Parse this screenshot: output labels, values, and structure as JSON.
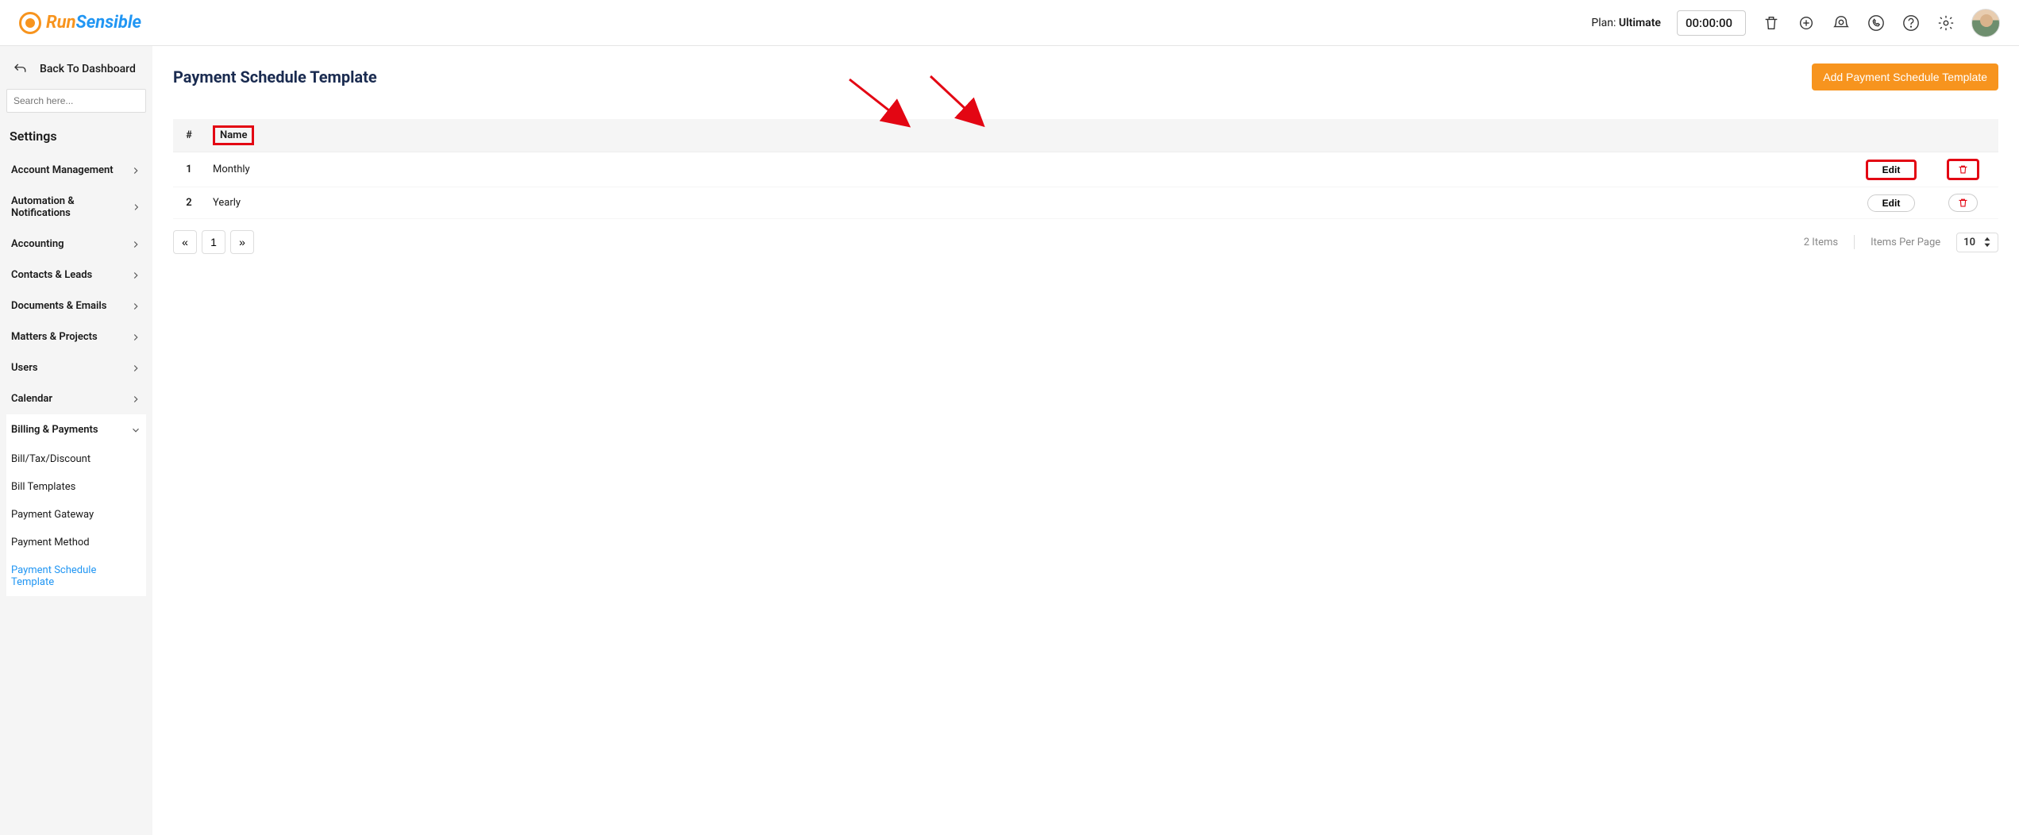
{
  "header": {
    "logo_run": "Run",
    "logo_sensible": "Sensible",
    "plan_label": "Plan: ",
    "plan_value": "Ultimate",
    "timer": "00:00:00"
  },
  "sidebar": {
    "back_label": "Back To Dashboard",
    "search_placeholder": "Search here...",
    "settings_title": "Settings",
    "menu": [
      {
        "label": "Account Management"
      },
      {
        "label": "Automation & Notifications"
      },
      {
        "label": "Accounting"
      },
      {
        "label": "Contacts & Leads"
      },
      {
        "label": "Documents & Emails"
      },
      {
        "label": "Matters & Projects"
      },
      {
        "label": "Users"
      },
      {
        "label": "Calendar"
      }
    ],
    "expanded": {
      "label": "Billing & Payments",
      "items": [
        {
          "label": "Bill/Tax/Discount"
        },
        {
          "label": "Bill Templates"
        },
        {
          "label": "Payment Gateway"
        },
        {
          "label": "Payment Method"
        },
        {
          "label": "Payment Schedule Template",
          "active": true
        }
      ]
    }
  },
  "main": {
    "title": "Payment Schedule Template",
    "add_button": "Add Payment Schedule Template",
    "columns": {
      "num": "#",
      "name": "Name"
    },
    "rows": [
      {
        "num": "1",
        "name": "Monthly",
        "edit": "Edit"
      },
      {
        "num": "2",
        "name": "Yearly",
        "edit": "Edit"
      }
    ],
    "pagination": {
      "prev": "«",
      "page": "1",
      "next": "»",
      "items": "2 Items",
      "per_page_label": "Items Per Page",
      "per_page_value": "10"
    }
  }
}
